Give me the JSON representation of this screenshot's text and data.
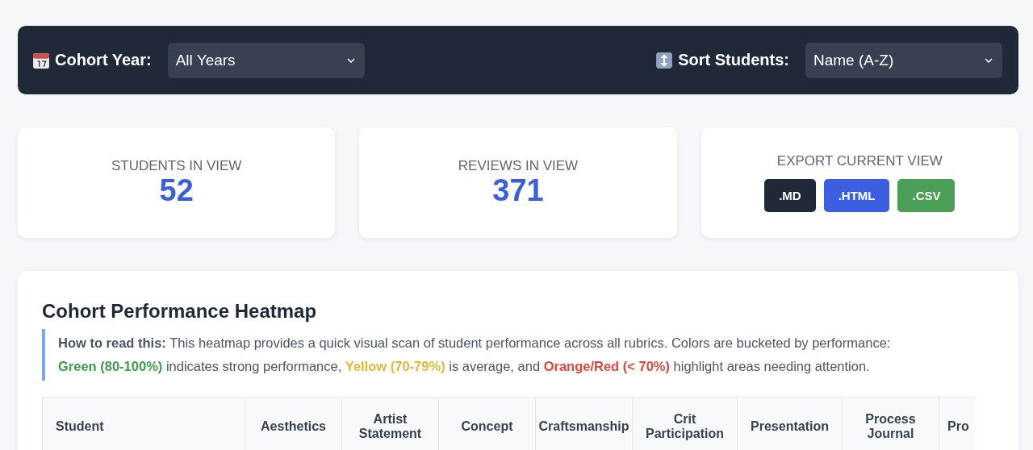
{
  "filters": [
    {
      "kind": "year",
      "label": "Cohort Year:",
      "value": "All Years"
    },
    {
      "kind": "sort",
      "label": "Sort Students:",
      "value": "Name (A-Z)"
    }
  ],
  "stats": [
    {
      "label": "STUDENTS IN VIEW",
      "value": "52"
    },
    {
      "label": "REVIEWS IN VIEW",
      "value": "371"
    }
  ],
  "export": {
    "label": "EXPORT CURRENT VIEW",
    "buttons": [
      {
        "label": ".MD",
        "kind": "dark"
      },
      {
        "label": ".HTML",
        "kind": "blue"
      },
      {
        "label": ".CSV",
        "kind": "green"
      }
    ]
  },
  "heatmap": {
    "title": "Cohort Performance Heatmap",
    "note": [
      {
        "kind": "strong",
        "text": "How to read this:"
      },
      {
        "kind": "plain",
        "text": " This heatmap provides a quick visual scan of student performance across all rubrics. Colors are bucketed by performance: "
      },
      {
        "kind": "good",
        "text": "Green (80-100%)"
      },
      {
        "kind": "plain",
        "text": " indicates strong performance, "
      },
      {
        "kind": "mid",
        "text": "Yellow (70-79%)"
      },
      {
        "kind": "plain",
        "text": " is average, and "
      },
      {
        "kind": "bad",
        "text": "Orange/Red (< 70%)"
      },
      {
        "kind": "plain",
        "text": " highlight areas needing attention."
      }
    ],
    "columns": [
      "Student",
      "Aesthetics",
      "Artist Statement",
      "Concept",
      "Craftsmanship",
      "Crit Participation",
      "Presentation",
      "Process Journal",
      "Pro"
    ]
  }
}
